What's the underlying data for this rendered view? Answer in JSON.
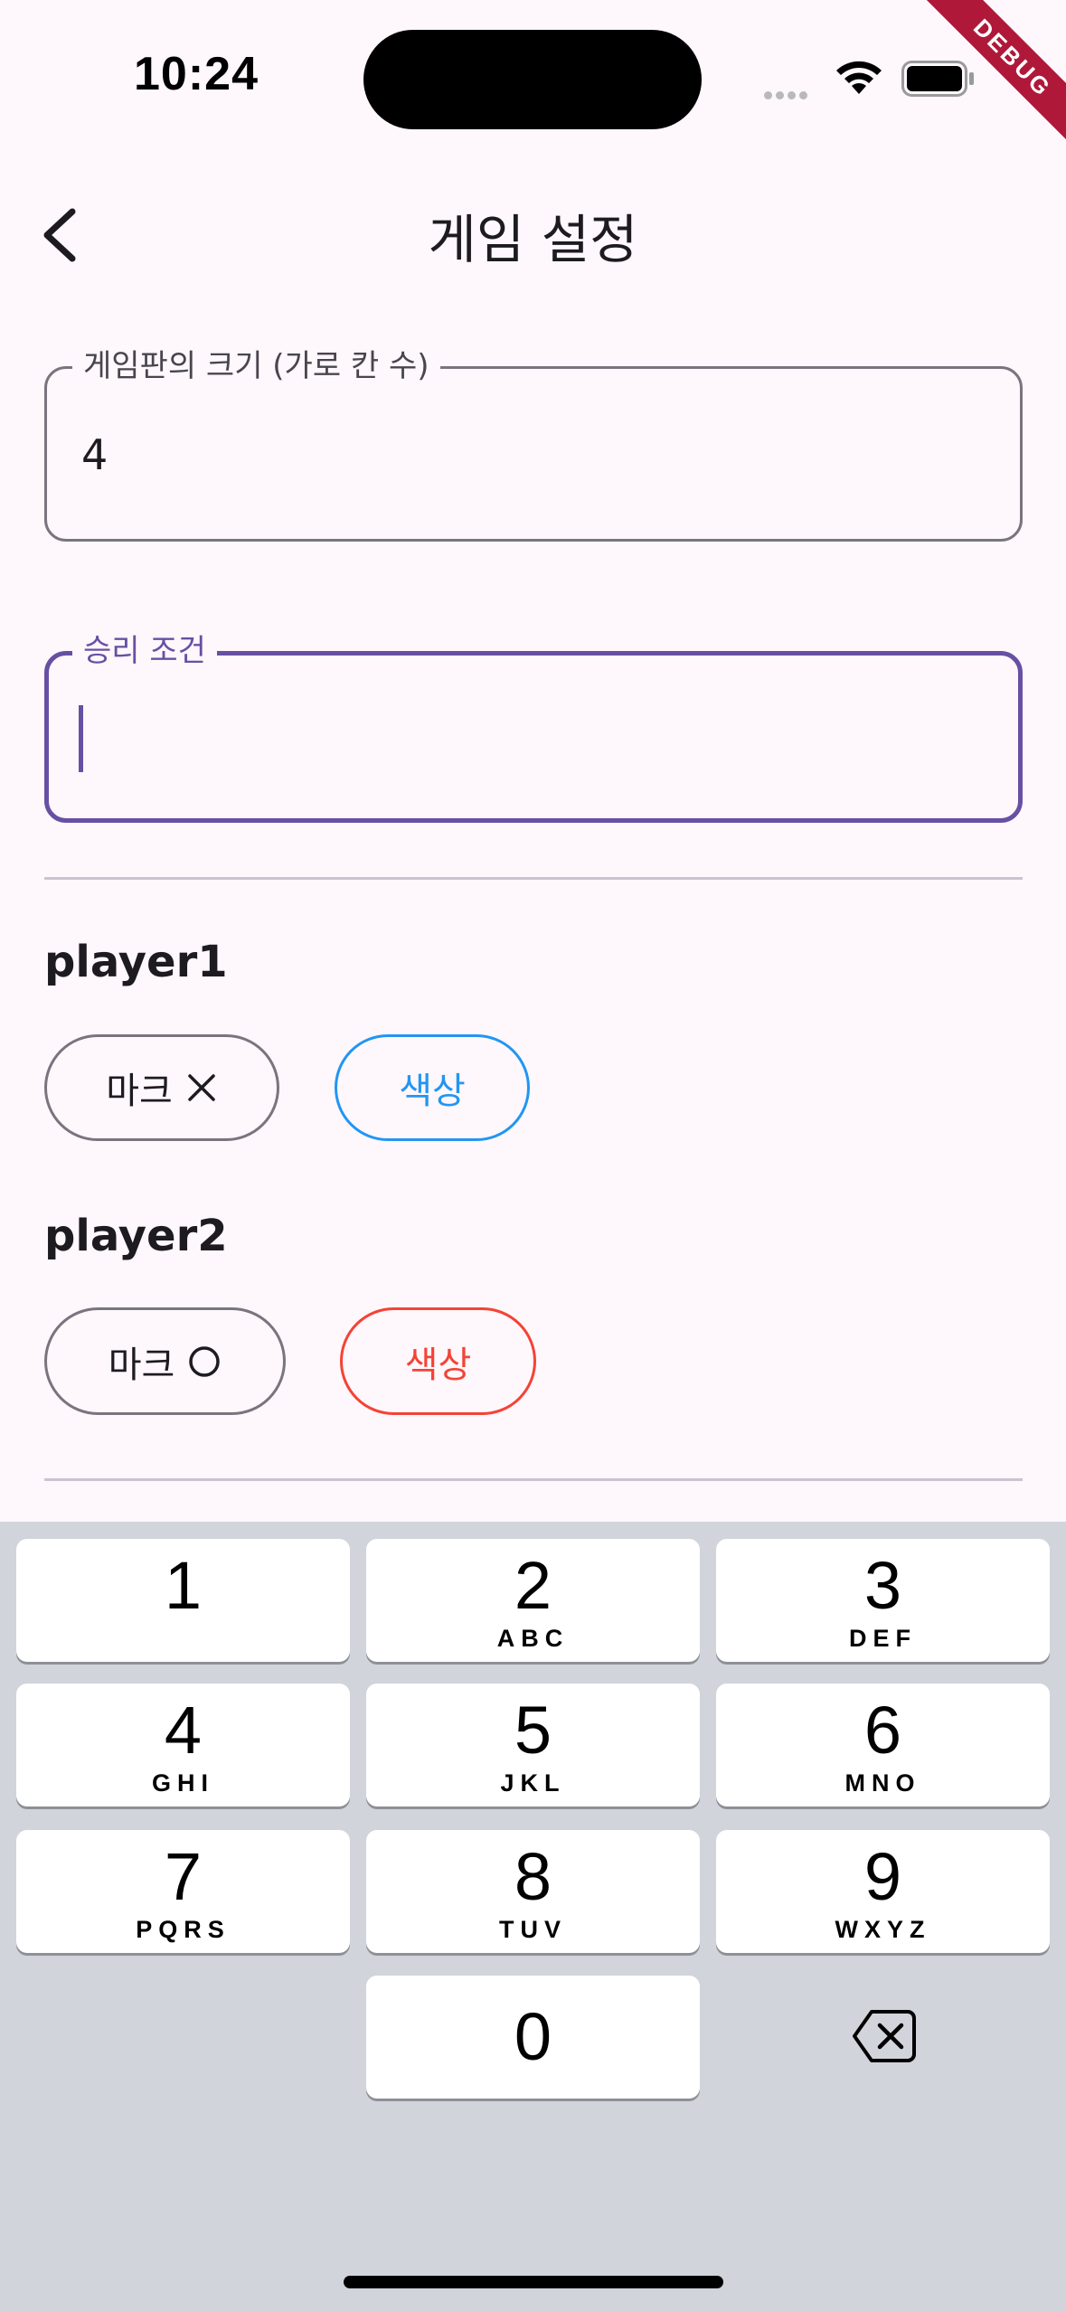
{
  "status_bar": {
    "time": "10:24"
  },
  "debug_banner": "DEBUG",
  "app_bar": {
    "title": "게임 설정"
  },
  "board_size_field": {
    "label": "게임판의 크기 (가로 칸 수)",
    "value": "4"
  },
  "win_condition_field": {
    "label": "승리 조건",
    "value": ""
  },
  "players": [
    {
      "name": "player1",
      "mark_label": "마크",
      "mark_symbol": "X",
      "color_label": "색상",
      "color": "#2196f3"
    },
    {
      "name": "player2",
      "mark_label": "마크",
      "mark_symbol": "O",
      "color_label": "색상",
      "color": "#f44336"
    }
  ],
  "keypad": {
    "keys": [
      {
        "digit": "1",
        "letters": ""
      },
      {
        "digit": "2",
        "letters": "ABC"
      },
      {
        "digit": "3",
        "letters": "DEF"
      },
      {
        "digit": "4",
        "letters": "GHI"
      },
      {
        "digit": "5",
        "letters": "JKL"
      },
      {
        "digit": "6",
        "letters": "MNO"
      },
      {
        "digit": "7",
        "letters": "PQRS"
      },
      {
        "digit": "8",
        "letters": "TUV"
      },
      {
        "digit": "9",
        "letters": "WXYZ"
      },
      {
        "digit": "0",
        "letters": ""
      }
    ],
    "delete_icon": "backspace-icon"
  },
  "colors": {
    "accent": "#6750a4",
    "background": "#fef7fb",
    "keyboard_bg": "#d1d4db"
  }
}
